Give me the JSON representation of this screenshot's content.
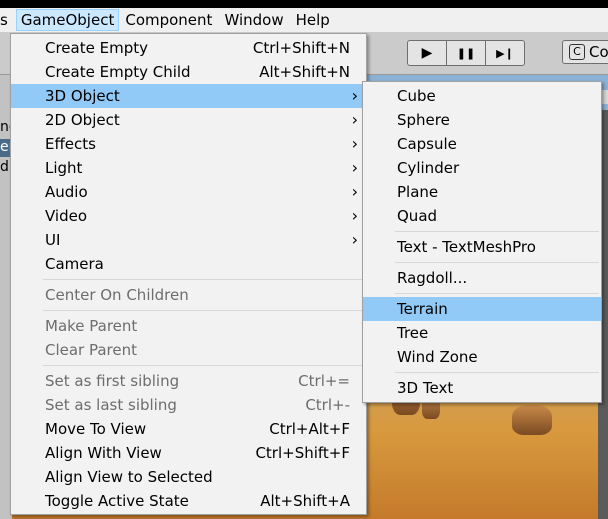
{
  "menubar": {
    "items": [
      {
        "label": "s",
        "state": "cut"
      },
      {
        "label": "GameObject",
        "state": "active"
      },
      {
        "label": "Component",
        "state": "normal"
      },
      {
        "label": "Window",
        "state": "normal"
      },
      {
        "label": "Help",
        "state": "normal"
      }
    ]
  },
  "toolbar": {
    "play_icon": "▶",
    "pause_icon": "❚❚",
    "step_icon": "▶❙",
    "collab_label": "Co"
  },
  "left_panel": {
    "row1": "ne",
    "row2": "er",
    "row3": "d L"
  },
  "gameobject_menu": {
    "items": [
      {
        "label": "Create Empty",
        "shortcut": "Ctrl+Shift+N",
        "state": "normal"
      },
      {
        "label": "Create Empty Child",
        "shortcut": "Alt+Shift+N",
        "state": "normal"
      },
      {
        "label": "3D Object",
        "submenu": true,
        "state": "highlighted"
      },
      {
        "label": "2D Object",
        "submenu": true,
        "state": "normal"
      },
      {
        "label": "Effects",
        "submenu": true,
        "state": "normal"
      },
      {
        "label": "Light",
        "submenu": true,
        "state": "normal"
      },
      {
        "label": "Audio",
        "submenu": true,
        "state": "normal"
      },
      {
        "label": "Video",
        "submenu": true,
        "state": "normal"
      },
      {
        "label": "UI",
        "submenu": true,
        "state": "normal"
      },
      {
        "label": "Camera",
        "state": "normal"
      },
      {
        "separator": true
      },
      {
        "label": "Center On Children",
        "state": "disabled"
      },
      {
        "separator": true
      },
      {
        "label": "Make Parent",
        "state": "disabled"
      },
      {
        "label": "Clear Parent",
        "state": "disabled"
      },
      {
        "separator": true
      },
      {
        "label": "Set as first sibling",
        "shortcut": "Ctrl+=",
        "state": "disabled"
      },
      {
        "label": "Set as last sibling",
        "shortcut": "Ctrl+-",
        "state": "disabled"
      },
      {
        "label": "Move To View",
        "shortcut": "Ctrl+Alt+F",
        "state": "normal"
      },
      {
        "label": "Align With View",
        "shortcut": "Ctrl+Shift+F",
        "state": "normal"
      },
      {
        "label": "Align View to Selected",
        "state": "normal"
      },
      {
        "label": "Toggle Active State",
        "shortcut": "Alt+Shift+A",
        "state": "normal"
      }
    ]
  },
  "submenu_3d": {
    "items": [
      {
        "label": "Cube",
        "state": "normal"
      },
      {
        "label": "Sphere",
        "state": "normal"
      },
      {
        "label": "Capsule",
        "state": "normal"
      },
      {
        "label": "Cylinder",
        "state": "normal"
      },
      {
        "label": "Plane",
        "state": "normal"
      },
      {
        "label": "Quad",
        "state": "normal"
      },
      {
        "separator": true
      },
      {
        "label": "Text - TextMeshPro",
        "state": "normal"
      },
      {
        "separator": true
      },
      {
        "label": "Ragdoll...",
        "state": "normal"
      },
      {
        "separator": true
      },
      {
        "label": "Terrain",
        "state": "highlighted"
      },
      {
        "label": "Tree",
        "state": "normal"
      },
      {
        "label": "Wind Zone",
        "state": "normal"
      },
      {
        "separator": true
      },
      {
        "label": "3D Text",
        "state": "normal"
      }
    ]
  },
  "colors": {
    "highlight": "#91c9f7",
    "menu_bg": "#f2f2f2",
    "active_menubar": "#cce8ff",
    "disabled_text": "#6d6d6d"
  }
}
